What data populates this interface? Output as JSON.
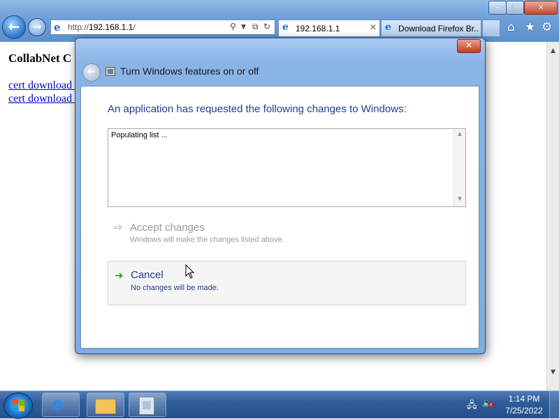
{
  "browser": {
    "url_prefix": "http://",
    "url_host": "192.168.1.1",
    "url_suffix": "/",
    "tabs": [
      {
        "label": "192.168.1.1"
      },
      {
        "label": "Download Firefox Br..."
      }
    ],
    "icons": [
      "back-icon",
      "forward-icon",
      "search-icon",
      "refresh-icon",
      "home-icon",
      "favorites-icon",
      "tools-icon"
    ]
  },
  "page": {
    "heading": "CollabNet C",
    "links": [
      "cert download (",
      "cert download ("
    ]
  },
  "dialog": {
    "title": "Turn Windows features on or off",
    "instruction": "An application has requested the following changes to Windows:",
    "list_text": "Populating list ...",
    "accept": {
      "title": "Accept changes",
      "description": "Windows will make the changes listed above.",
      "enabled": false
    },
    "cancel": {
      "title": "Cancel",
      "description": "No changes will be made."
    }
  },
  "taskbar": {
    "time": "1:14 PM",
    "date": "7/25/2022",
    "apps": [
      "internet-explorer",
      "windows-explorer",
      "control-panel"
    ]
  },
  "colors": {
    "instruction_text": "#1e3f8a",
    "disabled_text": "#9a9a9a",
    "link": "#0000cc",
    "taskbar": "#2f5d9a"
  }
}
